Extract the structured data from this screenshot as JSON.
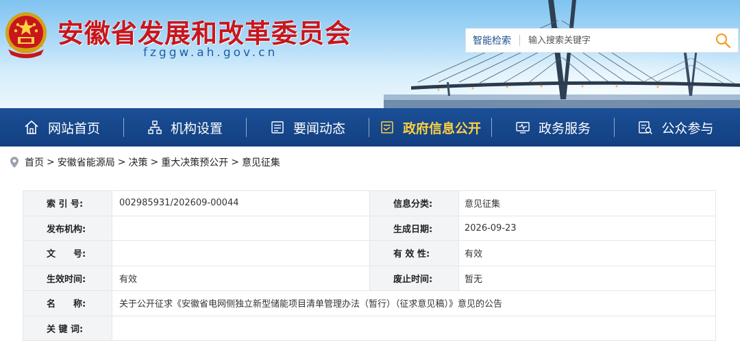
{
  "header": {
    "title": "安徽省发展和改革委员会",
    "domain": "fzggw.ah.gov.cn",
    "emblem_icon": "national-emblem-icon"
  },
  "search": {
    "label": "智能检索",
    "placeholder": "输入搜索关键字",
    "icon": "search-icon"
  },
  "nav": {
    "items": [
      {
        "label": "网站首页",
        "icon": "home-icon"
      },
      {
        "label": "机构设置",
        "icon": "org-chart-icon"
      },
      {
        "label": "要闻动态",
        "icon": "news-icon"
      },
      {
        "label": "政府信息公开",
        "icon": "info-disclosure-icon",
        "active": true
      },
      {
        "label": "政务服务",
        "icon": "service-monitor-icon"
      },
      {
        "label": "公众参与",
        "icon": "public-search-icon"
      }
    ]
  },
  "breadcrumb": {
    "items": [
      "首页",
      "安徽省能源局",
      "决策",
      "重大决策预公开",
      "意见征集"
    ],
    "separator": ">"
  },
  "info_table": {
    "index_label": "索 引 号:",
    "index_value": "002985931/202609-00044",
    "category_label": "信息分类:",
    "category_value": "意见征集",
    "publisher_label": "发布机构:",
    "publisher_value": "",
    "date_label": "生成日期:",
    "date_value": "2026-09-23",
    "docno_label": "文　　号:",
    "docno_value": "",
    "validity_label": "有 效 性:",
    "validity_value": "有效",
    "effective_label": "生效时间:",
    "effective_value": "有效",
    "expire_label": "废止时间:",
    "expire_value": "暂无",
    "name_label": "名　　称:",
    "name_value": "关于公开征求《安徽省电网侧独立新型储能项目清单管理办法（暂行）（征求意见稿）》意见的公告",
    "keywords_label": "关 键 词:",
    "keywords_value": ""
  },
  "colors": {
    "title_red": "#c8161d",
    "nav_blue": "#1b4f97",
    "nav_active": "#ffd23f"
  }
}
